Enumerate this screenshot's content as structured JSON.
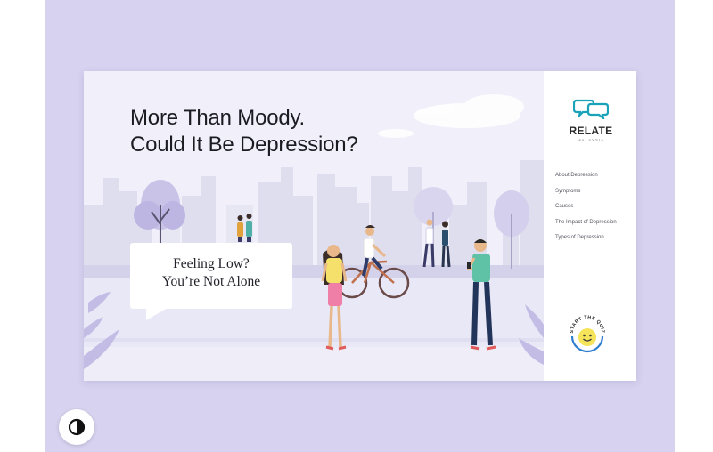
{
  "hero": {
    "headline_line1": "More Than Moody.",
    "headline_line2": "Could It Be Depression?",
    "bubble_line1": "Feeling Low?",
    "bubble_line2": "You’re Not Alone"
  },
  "sidebar": {
    "logo_name": "RELATE",
    "logo_subtitle": "MALAYSIA",
    "nav": [
      {
        "label": "About Depression"
      },
      {
        "label": "Symptoms"
      },
      {
        "label": "Causes"
      },
      {
        "label": "The Impact of Depression"
      },
      {
        "label": "Types of Depression"
      }
    ],
    "quiz_label": "START THE QUIZ"
  },
  "controls": {
    "contrast_icon": "contrast-icon"
  },
  "colors": {
    "frame_bg": "#d6d2ef",
    "hero_bg": "#f1f0fa",
    "accent_teal": "#1aa3b8",
    "quiz_yellow": "#f5e35a",
    "quiz_ring": "#2f7fd0"
  }
}
